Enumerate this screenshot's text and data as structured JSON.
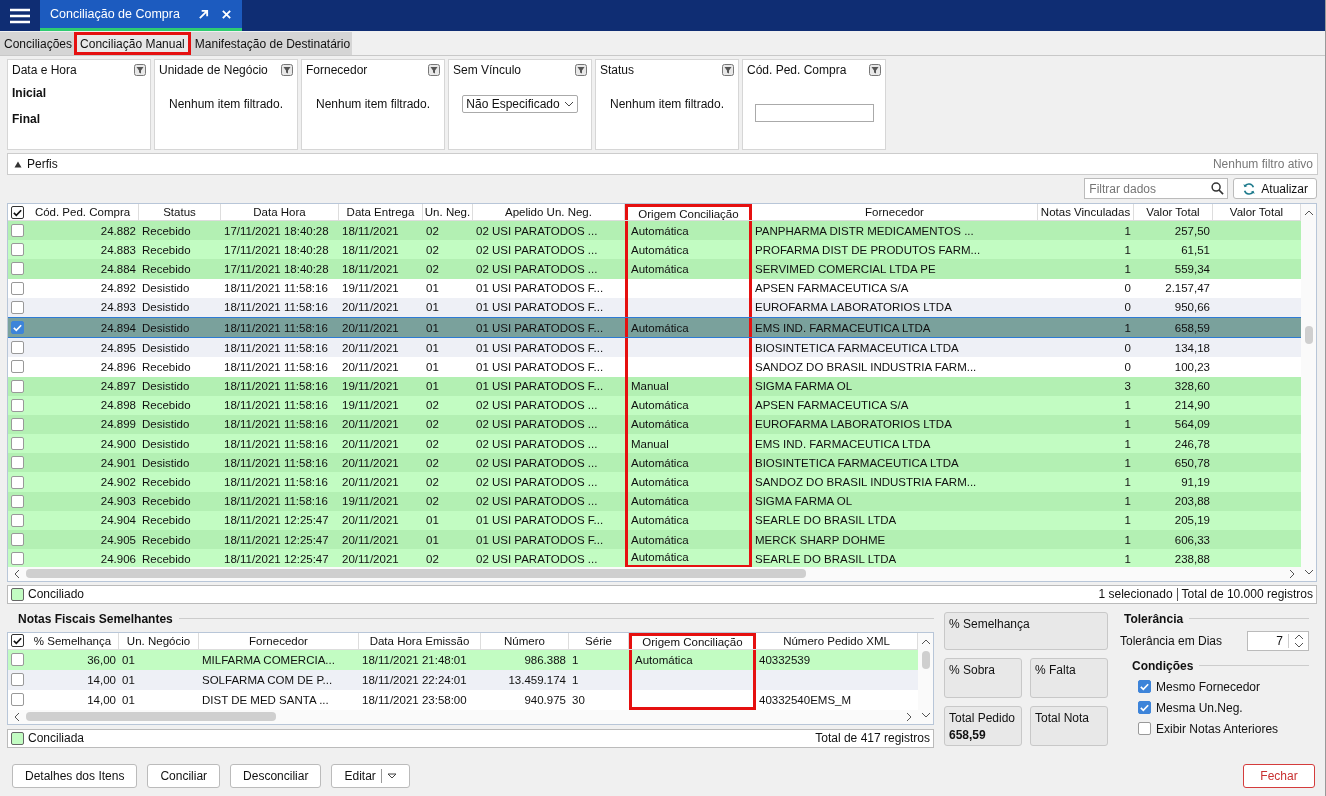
{
  "title_bar": {
    "tab_title": "Conciliação de Compra"
  },
  "tabs": [
    {
      "label": "Conciliações",
      "selected": false,
      "highlighted": false
    },
    {
      "label": "Conciliação Manual",
      "selected": true,
      "highlighted": true
    },
    {
      "label": "Manifestação de Destinatário",
      "selected": false,
      "highlighted": false
    }
  ],
  "filters": [
    {
      "kind": "date",
      "title": "Data e Hora",
      "labels": [
        "Inicial",
        "Final"
      ]
    },
    {
      "kind": "list",
      "title": "Unidade de Negócio",
      "text": "Nenhum item filtrado."
    },
    {
      "kind": "list",
      "title": "Fornecedor",
      "text": "Nenhum item filtrado."
    },
    {
      "kind": "select",
      "title": "Sem Vínculo",
      "value": "Não Especificado"
    },
    {
      "kind": "list",
      "title": "Status",
      "text": "Nenhum item filtrado."
    },
    {
      "kind": "input",
      "title": "Cód. Ped. Compra"
    }
  ],
  "profiles_bar": {
    "label": "Perfis",
    "status": "Nenhum filtro ativo"
  },
  "search": {
    "placeholder": "Filtrar dados"
  },
  "refresh_button": "Atualizar",
  "main_table": {
    "select_all_checked": true,
    "columns": [
      {
        "label": "Cód. Ped. Compra",
        "highlighted": false
      },
      {
        "label": "Status",
        "highlighted": false
      },
      {
        "label": "Data Hora",
        "highlighted": false
      },
      {
        "label": "Data Entrega",
        "highlighted": false
      },
      {
        "label": "Un. Neg.",
        "highlighted": false
      },
      {
        "label": "Apelido Un. Neg.",
        "highlighted": false
      },
      {
        "label": "Origem Conciliação",
        "highlighted": true
      },
      {
        "label": "Fornecedor",
        "highlighted": false
      },
      {
        "label": "Notas Vinculadas",
        "highlighted": false
      },
      {
        "label": "Valor Total",
        "highlighted": false
      },
      {
        "label": "Valor Total",
        "highlighted": false
      }
    ],
    "rows": [
      {
        "checked": false,
        "selected": false,
        "reconciled": true,
        "code": "24.882",
        "status": "Recebido",
        "datetime": "17/11/2021 18:40:28",
        "delivery": "18/11/2021",
        "unit": "02",
        "unit_alias": "02 USI PARATODOS ...",
        "origin": "Automática",
        "supplier": "PANPHARMA DISTR MEDICAMENTOS ...",
        "linked_notes": "1",
        "total": "257,50"
      },
      {
        "checked": false,
        "selected": false,
        "reconciled": true,
        "code": "24.883",
        "status": "Recebido",
        "datetime": "17/11/2021 18:40:28",
        "delivery": "18/11/2021",
        "unit": "02",
        "unit_alias": "02 USI PARATODOS ...",
        "origin": "Automática",
        "supplier": "PROFARMA DIST DE PRODUTOS FARM...",
        "linked_notes": "1",
        "total": "61,51"
      },
      {
        "checked": false,
        "selected": false,
        "reconciled": true,
        "code": "24.884",
        "status": "Recebido",
        "datetime": "17/11/2021 18:40:28",
        "delivery": "18/11/2021",
        "unit": "02",
        "unit_alias": "02 USI PARATODOS ...",
        "origin": "Automática",
        "supplier": "SERVIMED COMERCIAL LTDA PE",
        "linked_notes": "1",
        "total": "559,34"
      },
      {
        "checked": false,
        "selected": false,
        "reconciled": false,
        "code": "24.892",
        "status": "Desistido",
        "datetime": "18/11/2021 11:58:16",
        "delivery": "19/11/2021",
        "unit": "01",
        "unit_alias": "01 USI PARATODOS F...",
        "supplier": "APSEN FARMACEUTICA S/A",
        "linked_notes": "0",
        "total": "2.157,47"
      },
      {
        "checked": false,
        "selected": false,
        "reconciled": false,
        "code": "24.893",
        "status": "Desistido",
        "datetime": "18/11/2021 11:58:16",
        "delivery": "20/11/2021",
        "unit": "01",
        "unit_alias": "01 USI PARATODOS F...",
        "supplier": "EUROFARMA LABORATORIOS LTDA",
        "linked_notes": "0",
        "total": "950,66"
      },
      {
        "checked": true,
        "selected": true,
        "reconciled": true,
        "code": "24.894",
        "status": "Desistido",
        "datetime": "18/11/2021 11:58:16",
        "delivery": "20/11/2021",
        "unit": "01",
        "unit_alias": "01 USI PARATODOS F...",
        "origin": "Automática",
        "supplier": "EMS IND. FARMACEUTICA LTDA",
        "linked_notes": "1",
        "total": "658,59"
      },
      {
        "checked": false,
        "selected": false,
        "reconciled": false,
        "code": "24.895",
        "status": "Desistido",
        "datetime": "18/11/2021 11:58:16",
        "delivery": "20/11/2021",
        "unit": "01",
        "unit_alias": "01 USI PARATODOS F...",
        "supplier": "BIOSINTETICA FARMACEUTICA LTDA",
        "linked_notes": "0",
        "total": "134,18"
      },
      {
        "checked": false,
        "selected": false,
        "reconciled": false,
        "code": "24.896",
        "status": "Recebido",
        "datetime": "18/11/2021 11:58:16",
        "delivery": "20/11/2021",
        "unit": "01",
        "unit_alias": "01 USI PARATODOS F...",
        "supplier": "SANDOZ DO BRASIL INDUSTRIA FARM...",
        "linked_notes": "0",
        "total": "100,23"
      },
      {
        "checked": false,
        "selected": false,
        "reconciled": true,
        "code": "24.897",
        "status": "Desistido",
        "datetime": "18/11/2021 11:58:16",
        "delivery": "19/11/2021",
        "unit": "01",
        "unit_alias": "01 USI PARATODOS F...",
        "origin": "Manual",
        "supplier": "SIGMA FARMA OL",
        "linked_notes": "3",
        "total": "328,60"
      },
      {
        "checked": false,
        "selected": false,
        "reconciled": true,
        "code": "24.898",
        "status": "Recebido",
        "datetime": "18/11/2021 11:58:16",
        "delivery": "19/11/2021",
        "unit": "02",
        "unit_alias": "02 USI PARATODOS ...",
        "origin": "Automática",
        "supplier": "APSEN FARMACEUTICA S/A",
        "linked_notes": "1",
        "total": "214,90"
      },
      {
        "checked": false,
        "selected": false,
        "reconciled": true,
        "code": "24.899",
        "status": "Desistido",
        "datetime": "18/11/2021 11:58:16",
        "delivery": "20/11/2021",
        "unit": "02",
        "unit_alias": "02 USI PARATODOS ...",
        "origin": "Automática",
        "supplier": "EUROFARMA LABORATORIOS LTDA",
        "linked_notes": "1",
        "total": "564,09"
      },
      {
        "checked": false,
        "selected": false,
        "reconciled": true,
        "code": "24.900",
        "status": "Desistido",
        "datetime": "18/11/2021 11:58:16",
        "delivery": "20/11/2021",
        "unit": "02",
        "unit_alias": "02 USI PARATODOS ...",
        "origin": "Manual",
        "supplier": "EMS IND. FARMACEUTICA LTDA",
        "linked_notes": "1",
        "total": "246,78"
      },
      {
        "checked": false,
        "selected": false,
        "reconciled": true,
        "code": "24.901",
        "status": "Desistido",
        "datetime": "18/11/2021 11:58:16",
        "delivery": "20/11/2021",
        "unit": "02",
        "unit_alias": "02 USI PARATODOS ...",
        "origin": "Automática",
        "supplier": "BIOSINTETICA FARMACEUTICA LTDA",
        "linked_notes": "1",
        "total": "650,78"
      },
      {
        "checked": false,
        "selected": false,
        "reconciled": true,
        "code": "24.902",
        "status": "Recebido",
        "datetime": "18/11/2021 11:58:16",
        "delivery": "20/11/2021",
        "unit": "02",
        "unit_alias": "02 USI PARATODOS ...",
        "origin": "Automática",
        "supplier": "SANDOZ DO BRASIL INDUSTRIA FARM...",
        "linked_notes": "1",
        "total": "91,19"
      },
      {
        "checked": false,
        "selected": false,
        "reconciled": true,
        "code": "24.903",
        "status": "Recebido",
        "datetime": "18/11/2021 11:58:16",
        "delivery": "19/11/2021",
        "unit": "02",
        "unit_alias": "02 USI PARATODOS ...",
        "origin": "Automática",
        "supplier": "SIGMA FARMA OL",
        "linked_notes": "1",
        "total": "203,88"
      },
      {
        "checked": false,
        "selected": false,
        "reconciled": true,
        "code": "24.904",
        "status": "Recebido",
        "datetime": "18/11/2021 12:25:47",
        "delivery": "20/11/2021",
        "unit": "01",
        "unit_alias": "01 USI PARATODOS F...",
        "origin": "Automática",
        "supplier": "SEARLE DO BRASIL LTDA",
        "linked_notes": "1",
        "total": "205,19"
      },
      {
        "checked": false,
        "selected": false,
        "reconciled": true,
        "code": "24.905",
        "status": "Recebido",
        "datetime": "18/11/2021 12:25:47",
        "delivery": "20/11/2021",
        "unit": "01",
        "unit_alias": "01 USI PARATODOS F...",
        "origin": "Automática",
        "supplier": "MERCK SHARP DOHME",
        "linked_notes": "1",
        "total": "606,33"
      },
      {
        "checked": false,
        "selected": false,
        "reconciled": true,
        "code": "24.906",
        "status": "Recebido",
        "datetime": "18/11/2021 12:25:47",
        "delivery": "20/11/2021",
        "unit": "02",
        "unit_alias": "02 USI PARATODOS ...",
        "origin": "Automática",
        "supplier": "SEARLE DO BRASIL LTDA",
        "linked_notes": "1",
        "total": "238,88"
      }
    ]
  },
  "main_status": {
    "legend": "Conciliado",
    "selection": "1 selecionado",
    "total": "Total de 10.000 registros"
  },
  "similar_notes": {
    "title": "Notas Fiscais Semelhantes",
    "select_all_checked": true,
    "columns": [
      {
        "label": "% Semelhança",
        "highlighted": false
      },
      {
        "label": "Un. Negócio",
        "highlighted": false
      },
      {
        "label": "Fornecedor",
        "highlighted": false
      },
      {
        "label": "Data Hora Emissão",
        "highlighted": false
      },
      {
        "label": "Número",
        "highlighted": false
      },
      {
        "label": "Série",
        "highlighted": false
      },
      {
        "label": "Origem Conciliação",
        "highlighted": true
      },
      {
        "label": "Número Pedido XML",
        "highlighted": false
      }
    ],
    "rows": [
      {
        "checked": false,
        "reconciled": true,
        "similarity": "36,00",
        "unit": "01",
        "supplier": "MILFARMA COMERCIA...",
        "issued": "18/11/2021 21:48:01",
        "number": "986.388",
        "series": "1",
        "origin": "Automática",
        "order_xml": "40332539"
      },
      {
        "checked": false,
        "reconciled": false,
        "similarity": "14,00",
        "unit": "01",
        "supplier": "SOLFARMA COM DE P...",
        "issued": "18/11/2021 22:24:01",
        "number": "13.459.174",
        "series": "1"
      },
      {
        "checked": false,
        "reconciled": false,
        "similarity": "14,00",
        "unit": "01",
        "supplier": "DIST DE MED SANTA ...",
        "issued": "18/11/2021 23:58:00",
        "number": "940.975",
        "series": "30",
        "order_xml": "40332540EMS_M"
      }
    ],
    "legend": "Conciliada",
    "total": "Total de 417 registros"
  },
  "summary": [
    {
      "label": "% Semelhança"
    },
    {
      "label": "% Sobra"
    },
    {
      "label": "% Falta"
    },
    {
      "label": "Total Pedido",
      "value": "658,59"
    },
    {
      "label": "Total Nota"
    }
  ],
  "tolerance": {
    "title": "Tolerância",
    "label": "Tolerância em Dias",
    "value": "7"
  },
  "conditions": {
    "title": "Condições",
    "options": [
      {
        "label": "Mesmo Fornecedor",
        "checked": true
      },
      {
        "label": "Mesma Un.Neg.",
        "checked": true
      },
      {
        "label": "Exibir Notas Anteriores",
        "checked": false
      }
    ]
  },
  "buttons": [
    {
      "label": "Detalhes dos Itens",
      "kind": "plain"
    },
    {
      "label": "Conciliar",
      "kind": "plain"
    },
    {
      "label": "Desconciliar",
      "kind": "plain"
    },
    {
      "label": "Editar",
      "kind": "split"
    },
    {
      "label": "Fechar",
      "kind": "close"
    }
  ]
}
